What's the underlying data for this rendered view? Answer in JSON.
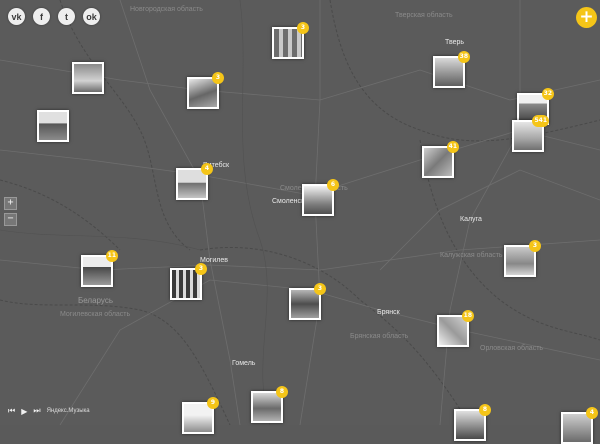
{
  "social": [
    {
      "id": "vk",
      "text": "vk",
      "icon": "vk-icon"
    },
    {
      "id": "facebook",
      "text": "f",
      "icon": "facebook-icon"
    },
    {
      "id": "twitter",
      "text": "t",
      "icon": "twitter-icon"
    },
    {
      "id": "odnoklassniki",
      "text": "ok",
      "icon": "odnoklassniki-icon"
    }
  ],
  "add_button": "+",
  "zoom": {
    "in": "+",
    "out": "−"
  },
  "player": {
    "prev": "⏮",
    "play": "▶",
    "next": "⏭",
    "label": "Яндекс.Музыка"
  },
  "map_labels": {
    "tver": "Тверь",
    "smolensk": "Смоленск",
    "vitebsk": "Витебск",
    "kaluga": "Калуга",
    "mogilev": "Могилев",
    "bryansk": "Брянск",
    "gomel": "Гомель",
    "belarus": "Беларусь",
    "tver_oblast": "Тверская область",
    "kaluga_oblast": "Калужская область",
    "bryansk_oblast": "Брянская область",
    "mogilev_oblast": "Могилевская область",
    "orel_oblast": "Орловская область",
    "novgorod_oblast": "Новгородская область",
    "smolensk_oblast": "Смоленская область"
  },
  "markers": [
    {
      "count": "3"
    },
    {
      "count": "3"
    },
    {
      "count": ""
    },
    {
      "count": ""
    },
    {
      "count": "38"
    },
    {
      "count": "32"
    },
    {
      "count": "541"
    },
    {
      "count": "41"
    },
    {
      "count": "4"
    },
    {
      "count": "6"
    },
    {
      "count": "3"
    },
    {
      "count": "11"
    },
    {
      "count": "3"
    },
    {
      "count": "3"
    },
    {
      "count": "18"
    },
    {
      "count": "8"
    },
    {
      "count": "9"
    },
    {
      "count": "8"
    },
    {
      "count": "4"
    }
  ],
  "colors": {
    "background": "#5a5a5a",
    "accent": "#f5c518",
    "marker_border": "#ffffff"
  }
}
